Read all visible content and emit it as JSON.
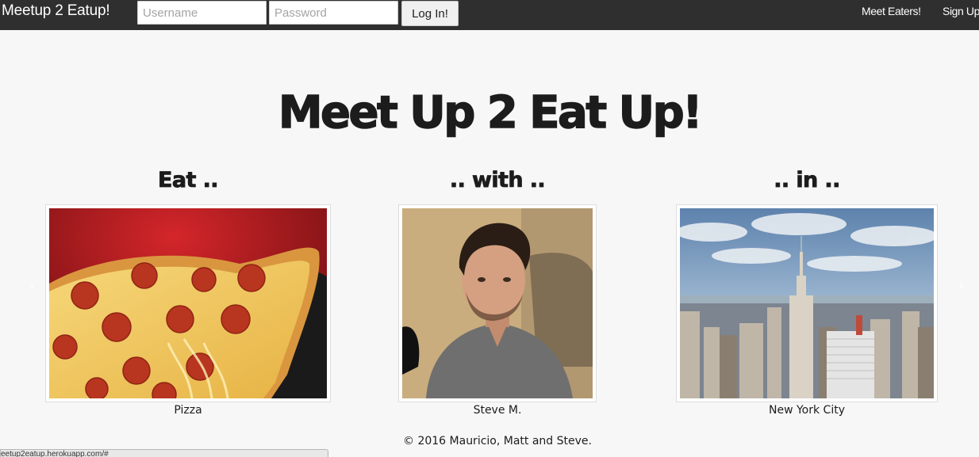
{
  "navbar": {
    "brand": "Meetup 2 Eatup!",
    "username_placeholder": "Username",
    "password_placeholder": "Password",
    "login_label": "Log In!",
    "links": [
      "Meet Eaters!",
      "Sign Up"
    ]
  },
  "hero": {
    "title": "Meet Up 2 Eat Up!",
    "columns": [
      {
        "heading": "Eat ..",
        "caption": "Pizza"
      },
      {
        "heading": ".. with ..",
        "caption": "Steve M."
      },
      {
        "heading": ".. in ..",
        "caption": "New York City"
      }
    ]
  },
  "carousel": {
    "prev_icon": "chevron-left-icon",
    "next_icon": "chevron-right-icon"
  },
  "footer": {
    "text": "© 2016 Mauricio, Matt and Steve."
  },
  "statusbar": {
    "url": "eetup2eatup.herokuapp.com/#"
  },
  "colors": {
    "navbar_bg": "#2f2f2f",
    "page_bg": "#f7f7f7",
    "text": "#1c1c1c"
  }
}
